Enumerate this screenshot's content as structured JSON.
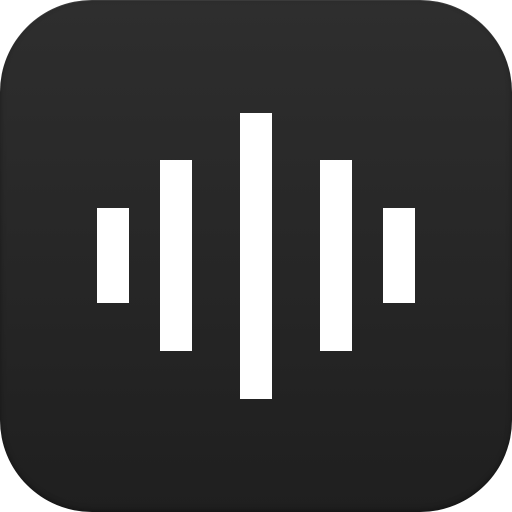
{
  "app_icon": {
    "name": "sound-wave-app-icon",
    "icon": "sound-wave-icon",
    "background_color": "#262626",
    "bar_color": "#ffffff"
  }
}
